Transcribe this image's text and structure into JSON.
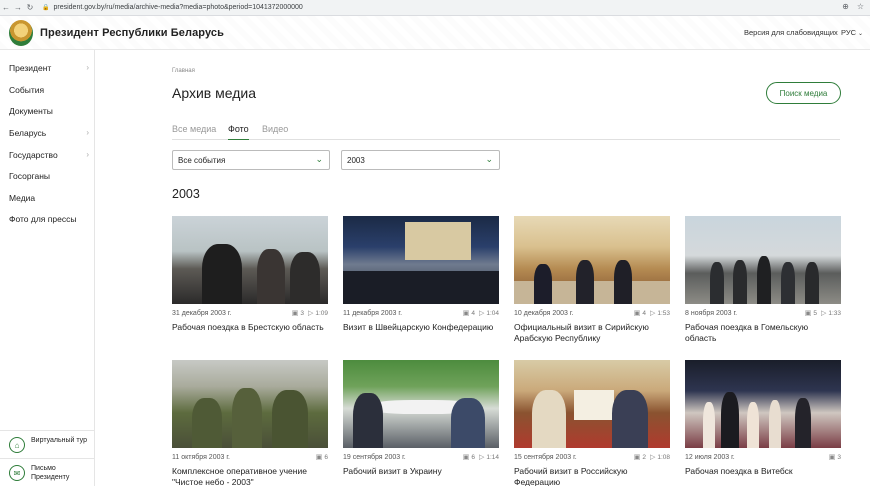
{
  "browser": {
    "url": "president.gov.by/ru/media/archive-media?media=photo&period=1041372000000"
  },
  "header": {
    "site_title": "Президент Республики Беларусь",
    "vision_link": "Версия для слабовидящих",
    "language": "РУС"
  },
  "sidebar": {
    "items": [
      {
        "label": "Президент",
        "arrow": true
      },
      {
        "label": "События",
        "arrow": false
      },
      {
        "label": "Документы",
        "arrow": false
      },
      {
        "label": "Беларусь",
        "arrow": true
      },
      {
        "label": "Государство",
        "arrow": true
      },
      {
        "label": "Госорганы",
        "arrow": false
      },
      {
        "label": "Медиа",
        "arrow": false
      },
      {
        "label": "Фото для прессы",
        "arrow": false
      }
    ],
    "footer": [
      {
        "label": "Виртуальный тур",
        "icon": "tour-icon"
      },
      {
        "label": "Письмо Президенту",
        "icon": "mail-icon"
      }
    ]
  },
  "main": {
    "breadcrumb": "Главная",
    "title": "Архив медиа",
    "search_button": "Поиск медиа",
    "tabs": [
      "Все медиа",
      "Фото",
      "Видео"
    ],
    "active_tab": "Фото",
    "filter_events": "Все события",
    "filter_year": "2003",
    "year_heading": "2003"
  },
  "cards": [
    {
      "date": "31 декабря 2003 г.",
      "photos": "3",
      "video": "1:09",
      "caption": "Рабочая поездка в Брестскую область"
    },
    {
      "date": "11 декабря 2003 г.",
      "photos": "4",
      "video": "1:04",
      "caption": "Визит в Швейцарскую Конфедерацию"
    },
    {
      "date": "10 декабря 2003 г.",
      "photos": "4",
      "video": "1:53",
      "caption": "Официальный визит в Сирийскую Арабскую Республику"
    },
    {
      "date": "8 ноября 2003 г.",
      "photos": "5",
      "video": "1:33",
      "caption": "Рабочая поездка в Гомельскую область"
    },
    {
      "date": "11 октября 2003 г.",
      "photos": "6",
      "video": "",
      "caption": "Комплексное оперативное учение \"Чистое небо - 2003\""
    },
    {
      "date": "19 сентября 2003 г.",
      "photos": "6",
      "video": "1:14",
      "caption": "Рабочий визит в Украину"
    },
    {
      "date": "15 сентября 2003 г.",
      "photos": "2",
      "video": "1:08",
      "caption": "Рабочий визит в Российскую Федерацию"
    },
    {
      "date": "12 июля 2003 г.",
      "photos": "3",
      "video": "",
      "caption": "Рабочая поездка в Витебск"
    }
  ],
  "colors": {
    "accent": "#2f7d3a",
    "text": "#222222",
    "muted": "#999999"
  }
}
